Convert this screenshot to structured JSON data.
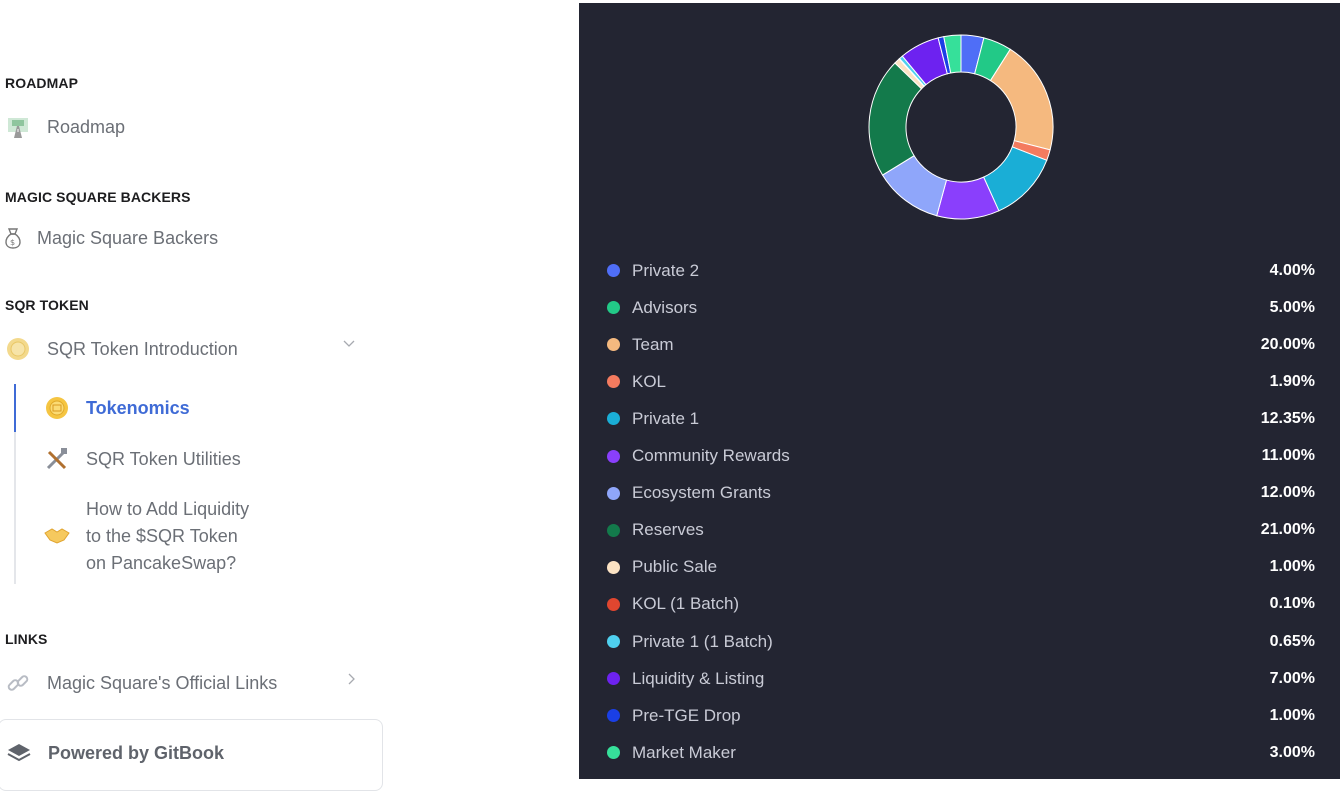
{
  "sidebar": {
    "sections": [
      {
        "title": "ROADMAP"
      },
      {
        "title": "MAGIC SQUARE BACKERS"
      },
      {
        "title": "SQR TOKEN"
      },
      {
        "title": "LINKS"
      }
    ],
    "items": {
      "roadmap": {
        "label": "Roadmap",
        "icon": "road-icon"
      },
      "backers": {
        "label": "Magic Square Backers",
        "icon": "money-bag-icon"
      },
      "intro": {
        "label": "SQR Token Introduction",
        "icon": "coin-icon"
      },
      "tokenomics": {
        "label": "Tokenomics",
        "icon": "coin-icon"
      },
      "utilities": {
        "label": "SQR Token Utilities",
        "icon": "tools-icon"
      },
      "liquidity": {
        "lines": [
          "How to Add Liquidity",
          "to the $SQR Token",
          "on PancakeSwap?"
        ],
        "icon": "handshake-icon"
      },
      "links": {
        "label": "Magic Square's Official Links",
        "icon": "link-icon"
      }
    },
    "powered_by": "Powered by GitBook",
    "accent": "#3f6bd6"
  },
  "chart_data": {
    "type": "pie",
    "categories": [
      "Private 2",
      "Advisors",
      "Team",
      "KOL",
      "Private 1",
      "Community Rewards",
      "Ecosystem Grants",
      "Reserves",
      "Public Sale",
      "KOL (1 Batch)",
      "Private 1 (1 Batch)",
      "Liquidity & Listing",
      "Pre-TGE Drop",
      "Market Maker"
    ],
    "values": [
      4.0,
      5.0,
      20.0,
      1.9,
      12.35,
      11.0,
      12.0,
      21.0,
      1.0,
      0.1,
      0.65,
      7.0,
      1.0,
      3.0
    ],
    "value_labels": [
      "4.00%",
      "5.00%",
      "20.00%",
      "1.90%",
      "12.35%",
      "11.00%",
      "12.00%",
      "21.00%",
      "1.00%",
      "0.10%",
      "0.65%",
      "7.00%",
      "1.00%",
      "3.00%"
    ],
    "colors": [
      "#4f6ef7",
      "#22c987",
      "#f5b97f",
      "#f47b5f",
      "#1aaed6",
      "#8a3ffc",
      "#8fa6fa",
      "#137a4b",
      "#fce3c4",
      "#e0462f",
      "#4fd0ef",
      "#6d22f0",
      "#1a3fe6",
      "#36e09a"
    ]
  }
}
